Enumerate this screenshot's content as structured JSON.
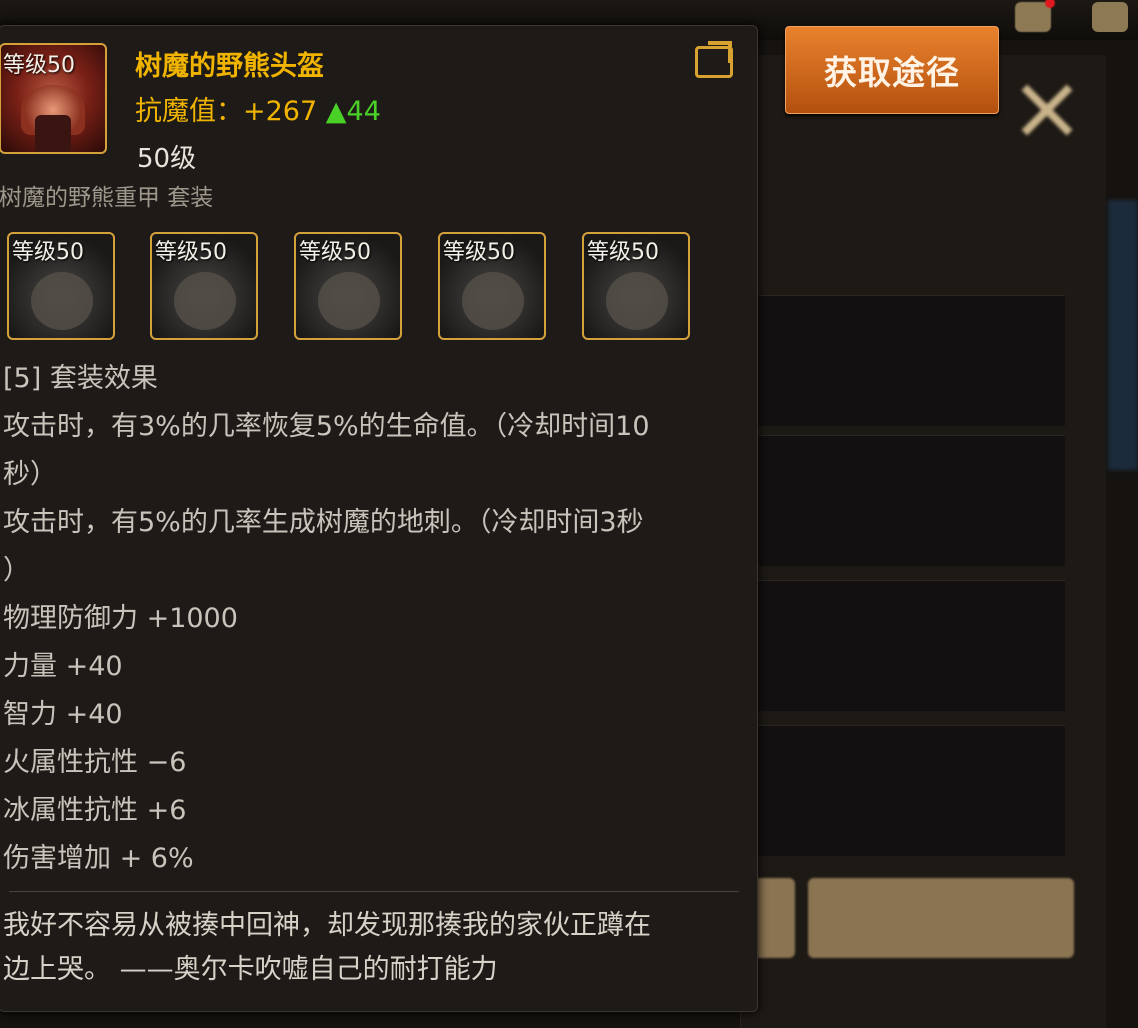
{
  "tooltip": {
    "icon_level": "等级50",
    "item_name": "树魔的野熊头盔",
    "stat_label": "抗魔值：",
    "stat_value": "+267",
    "stat_delta": "▲44",
    "required_level": "50级",
    "set_name": "树魔的野熊重甲 套装",
    "set_pieces": [
      "等级50",
      "等级50",
      "等级50",
      "等级50",
      "等级50"
    ],
    "set_effect_title": "[5] 套装效果",
    "set_effect_lines": [
      "攻击时，有3%的几率恢复5%的生命值。（冷却时间10",
      "秒）",
      "攻击时，有5%的几率生成树魔的地刺。（冷却时间3秒",
      "）"
    ],
    "attributes": [
      "物理防御力 +1000",
      "力量 +40",
      "智力 +40",
      "火属性抗性 −6",
      "冰属性抗性 +6",
      "伤害增加 + 6%"
    ],
    "lore_line1": "我好不容易从被揍中回神，却发现那揍我的家伙正蹲在",
    "lore_line2": "边上哭。 ——奥尔卡吹嘘自己的耐打能力"
  },
  "acquire_button": "获取途径",
  "colors": {
    "item_name": "#f0b400",
    "stat_up": "#4ad128",
    "acquire_button": "#d86a1e",
    "frame_gold": "#d4a03a"
  }
}
